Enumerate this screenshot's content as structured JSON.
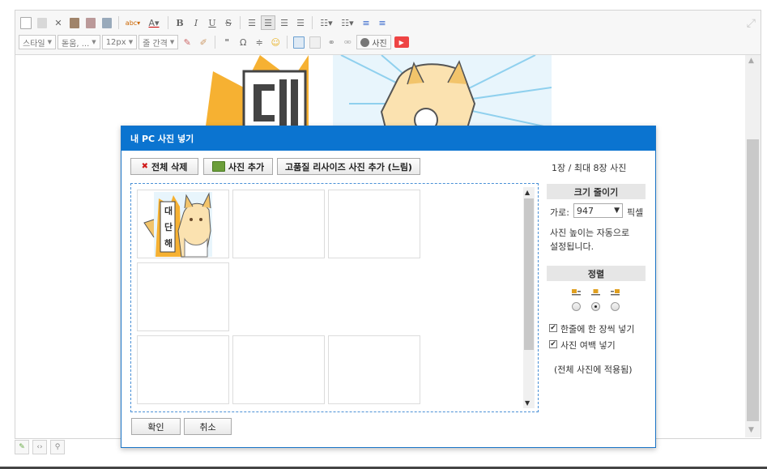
{
  "toolbar": {
    "style_label": "스타일",
    "font_label": "돋움, ...",
    "size_label": "12px",
    "lineheight_label": "줄 간격",
    "photo_label": "사진"
  },
  "dialog": {
    "title": "내 PC 사진 넣기",
    "delete_all_label": "전체 삭제",
    "add_photo_label": "사진 추가",
    "add_hq_label": "고품질 리사이즈 사진 추가 (느림)",
    "count_text": "1장 / 최대 8장 사진",
    "thumbnail_text": [
      "대",
      "단",
      "해"
    ],
    "resize": {
      "title": "크기 줄이기",
      "width_label": "가로:",
      "width_value": "947",
      "unit": "픽셀",
      "note_line1": "사진 높이는 자동으로",
      "note_line2": "설정됩니다."
    },
    "align": {
      "title": "정렬",
      "options": [
        "left",
        "center",
        "right"
      ],
      "selected": "center"
    },
    "options": {
      "one_per_line_label": "한줄에 한 장씩 넣기",
      "one_per_line_checked": true,
      "margin_label": "사진 여백 넣기",
      "margin_checked": true,
      "apply_note": "(전체 사진에 적용됨)"
    },
    "ok_label": "확인",
    "cancel_label": "취소"
  },
  "colors": {
    "dialog_header": "#0b74d0",
    "dropzone_border": "#4a90d6",
    "delete_icon": "#d01a1a"
  }
}
